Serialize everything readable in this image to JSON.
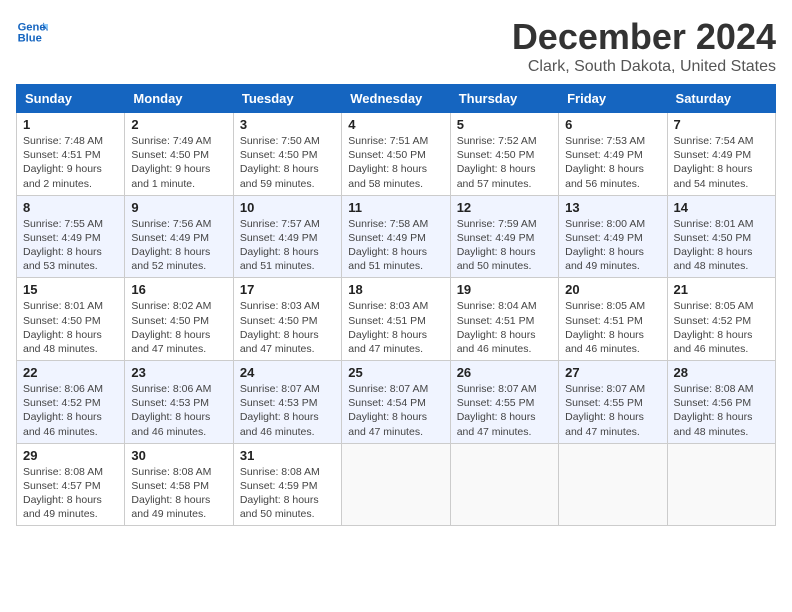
{
  "header": {
    "logo_line1": "General",
    "logo_line2": "Blue",
    "title": "December 2024",
    "subtitle": "Clark, South Dakota, United States"
  },
  "weekdays": [
    "Sunday",
    "Monday",
    "Tuesday",
    "Wednesday",
    "Thursday",
    "Friday",
    "Saturday"
  ],
  "weeks": [
    [
      {
        "day": "1",
        "sunrise": "Sunrise: 7:48 AM",
        "sunset": "Sunset: 4:51 PM",
        "daylight": "Daylight: 9 hours and 2 minutes."
      },
      {
        "day": "2",
        "sunrise": "Sunrise: 7:49 AM",
        "sunset": "Sunset: 4:50 PM",
        "daylight": "Daylight: 9 hours and 1 minute."
      },
      {
        "day": "3",
        "sunrise": "Sunrise: 7:50 AM",
        "sunset": "Sunset: 4:50 PM",
        "daylight": "Daylight: 8 hours and 59 minutes."
      },
      {
        "day": "4",
        "sunrise": "Sunrise: 7:51 AM",
        "sunset": "Sunset: 4:50 PM",
        "daylight": "Daylight: 8 hours and 58 minutes."
      },
      {
        "day": "5",
        "sunrise": "Sunrise: 7:52 AM",
        "sunset": "Sunset: 4:50 PM",
        "daylight": "Daylight: 8 hours and 57 minutes."
      },
      {
        "day": "6",
        "sunrise": "Sunrise: 7:53 AM",
        "sunset": "Sunset: 4:49 PM",
        "daylight": "Daylight: 8 hours and 56 minutes."
      },
      {
        "day": "7",
        "sunrise": "Sunrise: 7:54 AM",
        "sunset": "Sunset: 4:49 PM",
        "daylight": "Daylight: 8 hours and 54 minutes."
      }
    ],
    [
      {
        "day": "8",
        "sunrise": "Sunrise: 7:55 AM",
        "sunset": "Sunset: 4:49 PM",
        "daylight": "Daylight: 8 hours and 53 minutes."
      },
      {
        "day": "9",
        "sunrise": "Sunrise: 7:56 AM",
        "sunset": "Sunset: 4:49 PM",
        "daylight": "Daylight: 8 hours and 52 minutes."
      },
      {
        "day": "10",
        "sunrise": "Sunrise: 7:57 AM",
        "sunset": "Sunset: 4:49 PM",
        "daylight": "Daylight: 8 hours and 51 minutes."
      },
      {
        "day": "11",
        "sunrise": "Sunrise: 7:58 AM",
        "sunset": "Sunset: 4:49 PM",
        "daylight": "Daylight: 8 hours and 51 minutes."
      },
      {
        "day": "12",
        "sunrise": "Sunrise: 7:59 AM",
        "sunset": "Sunset: 4:49 PM",
        "daylight": "Daylight: 8 hours and 50 minutes."
      },
      {
        "day": "13",
        "sunrise": "Sunrise: 8:00 AM",
        "sunset": "Sunset: 4:49 PM",
        "daylight": "Daylight: 8 hours and 49 minutes."
      },
      {
        "day": "14",
        "sunrise": "Sunrise: 8:01 AM",
        "sunset": "Sunset: 4:50 PM",
        "daylight": "Daylight: 8 hours and 48 minutes."
      }
    ],
    [
      {
        "day": "15",
        "sunrise": "Sunrise: 8:01 AM",
        "sunset": "Sunset: 4:50 PM",
        "daylight": "Daylight: 8 hours and 48 minutes."
      },
      {
        "day": "16",
        "sunrise": "Sunrise: 8:02 AM",
        "sunset": "Sunset: 4:50 PM",
        "daylight": "Daylight: 8 hours and 47 minutes."
      },
      {
        "day": "17",
        "sunrise": "Sunrise: 8:03 AM",
        "sunset": "Sunset: 4:50 PM",
        "daylight": "Daylight: 8 hours and 47 minutes."
      },
      {
        "day": "18",
        "sunrise": "Sunrise: 8:03 AM",
        "sunset": "Sunset: 4:51 PM",
        "daylight": "Daylight: 8 hours and 47 minutes."
      },
      {
        "day": "19",
        "sunrise": "Sunrise: 8:04 AM",
        "sunset": "Sunset: 4:51 PM",
        "daylight": "Daylight: 8 hours and 46 minutes."
      },
      {
        "day": "20",
        "sunrise": "Sunrise: 8:05 AM",
        "sunset": "Sunset: 4:51 PM",
        "daylight": "Daylight: 8 hours and 46 minutes."
      },
      {
        "day": "21",
        "sunrise": "Sunrise: 8:05 AM",
        "sunset": "Sunset: 4:52 PM",
        "daylight": "Daylight: 8 hours and 46 minutes."
      }
    ],
    [
      {
        "day": "22",
        "sunrise": "Sunrise: 8:06 AM",
        "sunset": "Sunset: 4:52 PM",
        "daylight": "Daylight: 8 hours and 46 minutes."
      },
      {
        "day": "23",
        "sunrise": "Sunrise: 8:06 AM",
        "sunset": "Sunset: 4:53 PM",
        "daylight": "Daylight: 8 hours and 46 minutes."
      },
      {
        "day": "24",
        "sunrise": "Sunrise: 8:07 AM",
        "sunset": "Sunset: 4:53 PM",
        "daylight": "Daylight: 8 hours and 46 minutes."
      },
      {
        "day": "25",
        "sunrise": "Sunrise: 8:07 AM",
        "sunset": "Sunset: 4:54 PM",
        "daylight": "Daylight: 8 hours and 47 minutes."
      },
      {
        "day": "26",
        "sunrise": "Sunrise: 8:07 AM",
        "sunset": "Sunset: 4:55 PM",
        "daylight": "Daylight: 8 hours and 47 minutes."
      },
      {
        "day": "27",
        "sunrise": "Sunrise: 8:07 AM",
        "sunset": "Sunset: 4:55 PM",
        "daylight": "Daylight: 8 hours and 47 minutes."
      },
      {
        "day": "28",
        "sunrise": "Sunrise: 8:08 AM",
        "sunset": "Sunset: 4:56 PM",
        "daylight": "Daylight: 8 hours and 48 minutes."
      }
    ],
    [
      {
        "day": "29",
        "sunrise": "Sunrise: 8:08 AM",
        "sunset": "Sunset: 4:57 PM",
        "daylight": "Daylight: 8 hours and 49 minutes."
      },
      {
        "day": "30",
        "sunrise": "Sunrise: 8:08 AM",
        "sunset": "Sunset: 4:58 PM",
        "daylight": "Daylight: 8 hours and 49 minutes."
      },
      {
        "day": "31",
        "sunrise": "Sunrise: 8:08 AM",
        "sunset": "Sunset: 4:59 PM",
        "daylight": "Daylight: 8 hours and 50 minutes."
      },
      null,
      null,
      null,
      null
    ]
  ]
}
